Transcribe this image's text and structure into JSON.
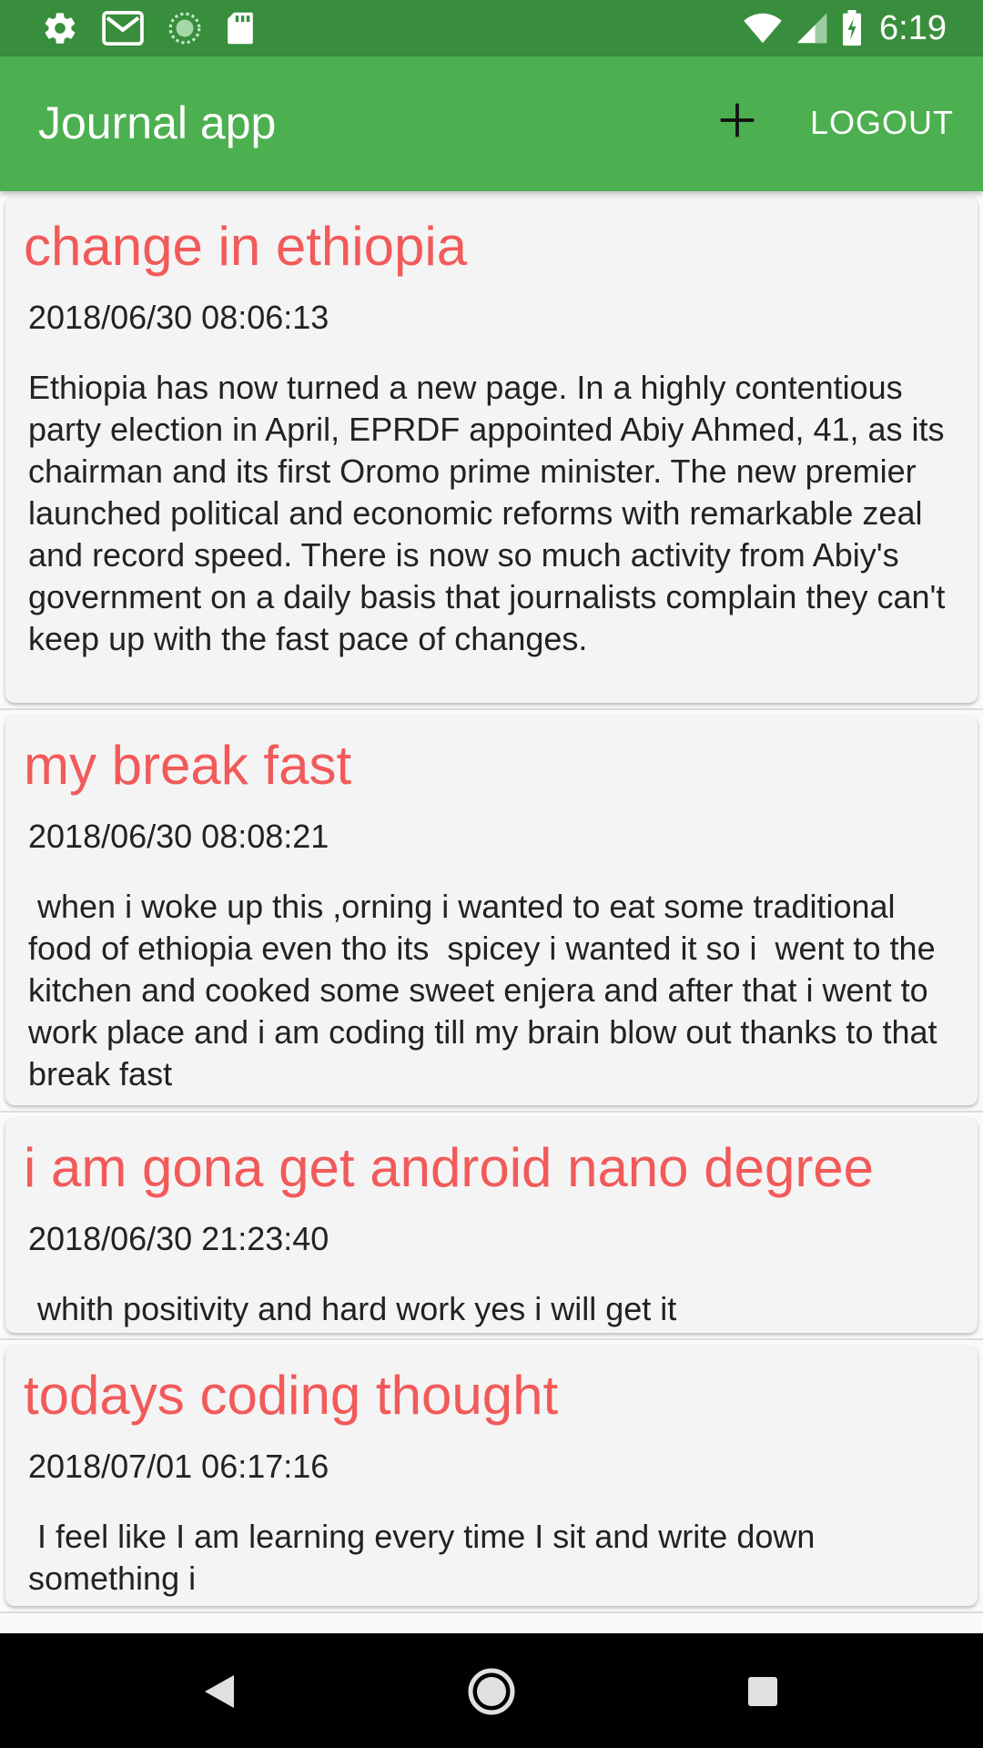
{
  "status_bar": {
    "time": "6:19",
    "left_icons": [
      "settings-icon",
      "gmail-icon",
      "sync-icon",
      "sd-card-icon"
    ],
    "right_icons": [
      "wifi-icon",
      "signal-icon",
      "battery-charging-icon"
    ]
  },
  "app_bar": {
    "title": "Journal app",
    "add_icon": "plus-icon",
    "logout_label": "LOGOUT",
    "color": "#4caf50",
    "status_color": "#388e3c"
  },
  "entries": [
    {
      "title": "change in ethiopia",
      "date": "2018/06/30 08:06:13",
      "body": "Ethiopia has now turned a new page. In a highly contentious party election in April, EPRDF appointed Abiy Ahmed, 41, as its chairman and its first Oromo prime minister. The new premier launched political and economic reforms with remarkable zeal and record speed. There is now so much activity from Abiy's government on a daily basis that journalists complain they can't keep up with the fast pace of changes."
    },
    {
      "title": "my break fast",
      "date": "2018/06/30 08:08:21",
      "body": " when i woke up this ,orning i wanted to eat some traditional food of ethiopia even tho its  spicey i wanted it so i  went to the kitchen and cooked some sweet enjera and after that i went to work place and i am coding till my brain blow out thanks to that break fast"
    },
    {
      "title": "i am gona get android nano degree",
      "date": "2018/06/30 21:23:40",
      "body": " whith positivity and hard work yes i will get it"
    },
    {
      "title": " todays coding thought",
      "date": "2018/07/01 06:17:16",
      "body": " I feel like I am learning every time I sit and write down something i"
    }
  ],
  "accent_title_color": "#f25a5a",
  "nav_bar": {
    "back_icon": "back-triangle-icon",
    "home_icon": "home-circle-icon",
    "recents_icon": "recents-square-icon"
  }
}
